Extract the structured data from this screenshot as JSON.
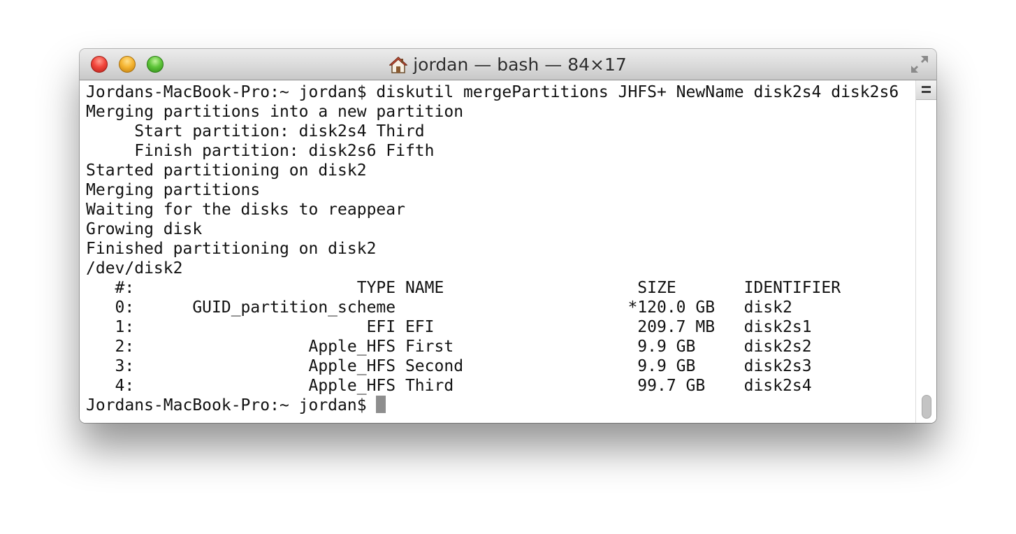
{
  "window": {
    "title": "jordan — bash — 84×17",
    "title_icon": "home-icon",
    "controls": {
      "close": "close-button",
      "minimize": "minimize-button",
      "zoom": "zoom-button",
      "fullscreen_icon": "fullscreen-icon"
    },
    "colors": {
      "close": "#f2463c",
      "minimize": "#f5b532",
      "zoom": "#5fc53a",
      "background": "#ffffff",
      "text": "#111111",
      "cursor": "#8e8e8e"
    }
  },
  "terminal": {
    "lines": [
      "Jordans-MacBook-Pro:~ jordan$ diskutil mergePartitions JHFS+ NewName disk2s4 disk2s6",
      "Merging partitions into a new partition",
      "     Start partition: disk2s4 Third",
      "     Finish partition: disk2s6 Fifth",
      "Started partitioning on disk2",
      "Merging partitions",
      "Waiting for the disks to reappear",
      "Growing disk",
      "Finished partitioning on disk2",
      "/dev/disk2",
      "   #:                       TYPE NAME                    SIZE       IDENTIFIER",
      "   0:      GUID_partition_scheme                        *120.0 GB   disk2",
      "   1:                        EFI EFI                     209.7 MB   disk2s1",
      "   2:                  Apple_HFS First                   9.9 GB     disk2s2",
      "   3:                  Apple_HFS Second                  9.9 GB     disk2s3",
      "   4:                  Apple_HFS Third                   99.7 GB    disk2s4"
    ],
    "prompt": "Jordans-MacBook-Pro:~ jordan$ "
  }
}
